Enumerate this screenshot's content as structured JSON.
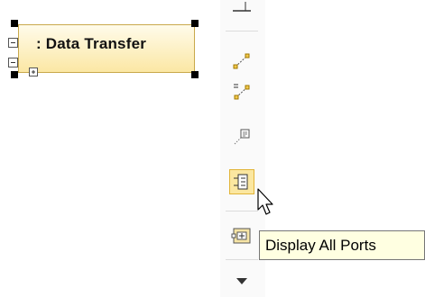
{
  "diagram": {
    "part": {
      "name": ": Data Transfer"
    }
  },
  "toolbar": {
    "buttons": [
      {
        "name": "connector-tool",
        "icon": "connector-icon"
      },
      {
        "name": "multi-connector-tool",
        "icon": "multi-connector-icon"
      },
      {
        "name": "note-anchor-tool",
        "icon": "note-anchor-icon"
      },
      {
        "name": "port-tool",
        "icon": "port-icon",
        "selected": true
      },
      {
        "name": "display-all-ports",
        "icon": "display-ports-icon"
      },
      {
        "name": "more",
        "icon": "chevron-down-icon"
      }
    ]
  },
  "tooltip": {
    "text": "Display All Ports"
  },
  "colors": {
    "part_fill_top": "#fffbea",
    "part_fill_bottom": "#fbe7a4",
    "selected_button": "#fbe7a0",
    "tooltip_bg": "#ffffe1"
  }
}
